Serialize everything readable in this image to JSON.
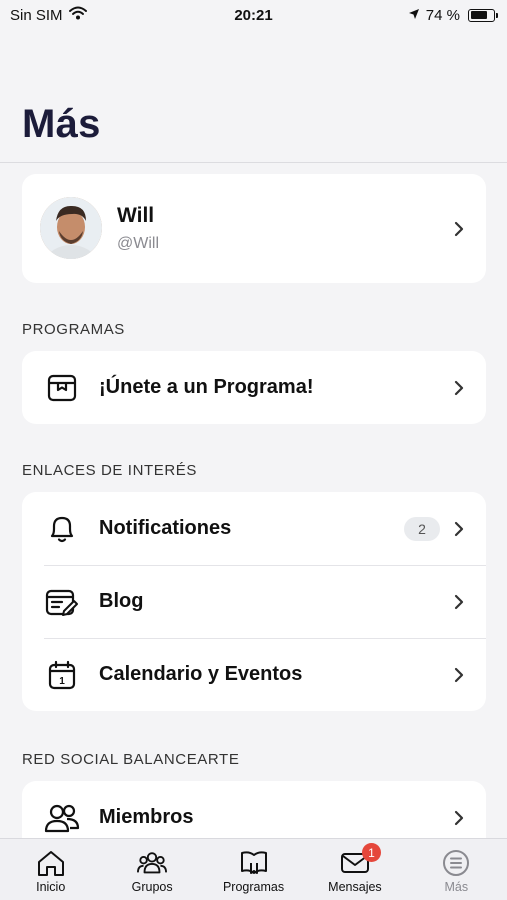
{
  "status_bar": {
    "carrier": "Sin SIM",
    "time": "20:21",
    "battery": "74 %",
    "battery_level": 0.74
  },
  "header": {
    "title": "Más"
  },
  "profile": {
    "name": "Will",
    "handle": "@Will"
  },
  "sections": {
    "programas": {
      "title": "PROGRAMAS",
      "items": [
        {
          "label": "¡Únete a un Programa!",
          "icon": "box-icon"
        }
      ]
    },
    "enlaces": {
      "title": "ENLACES DE INTERÉS",
      "items": [
        {
          "label": "Notificationes",
          "icon": "bell-icon",
          "badge": "2"
        },
        {
          "label": "Blog",
          "icon": "blog-icon"
        },
        {
          "label": "Calendario y Eventos",
          "icon": "calendar-icon",
          "calendar_day": "1"
        }
      ]
    },
    "red_social": {
      "title": "RED SOCIAL BALANCEARTE",
      "items": [
        {
          "label": "Miembros",
          "icon": "members-icon"
        }
      ]
    }
  },
  "tab_bar": {
    "tabs": [
      {
        "label": "Inicio",
        "icon": "home-icon"
      },
      {
        "label": "Grupos",
        "icon": "groups-icon"
      },
      {
        "label": "Programas",
        "icon": "programs-icon"
      },
      {
        "label": "Mensajes",
        "icon": "mail-icon",
        "badge": "1"
      },
      {
        "label": "Más",
        "icon": "menu-list-icon",
        "active": true
      }
    ]
  },
  "colors": {
    "accent_badge": "#e5473b",
    "title": "#1c1c3a",
    "background": "#f4f4f6"
  }
}
